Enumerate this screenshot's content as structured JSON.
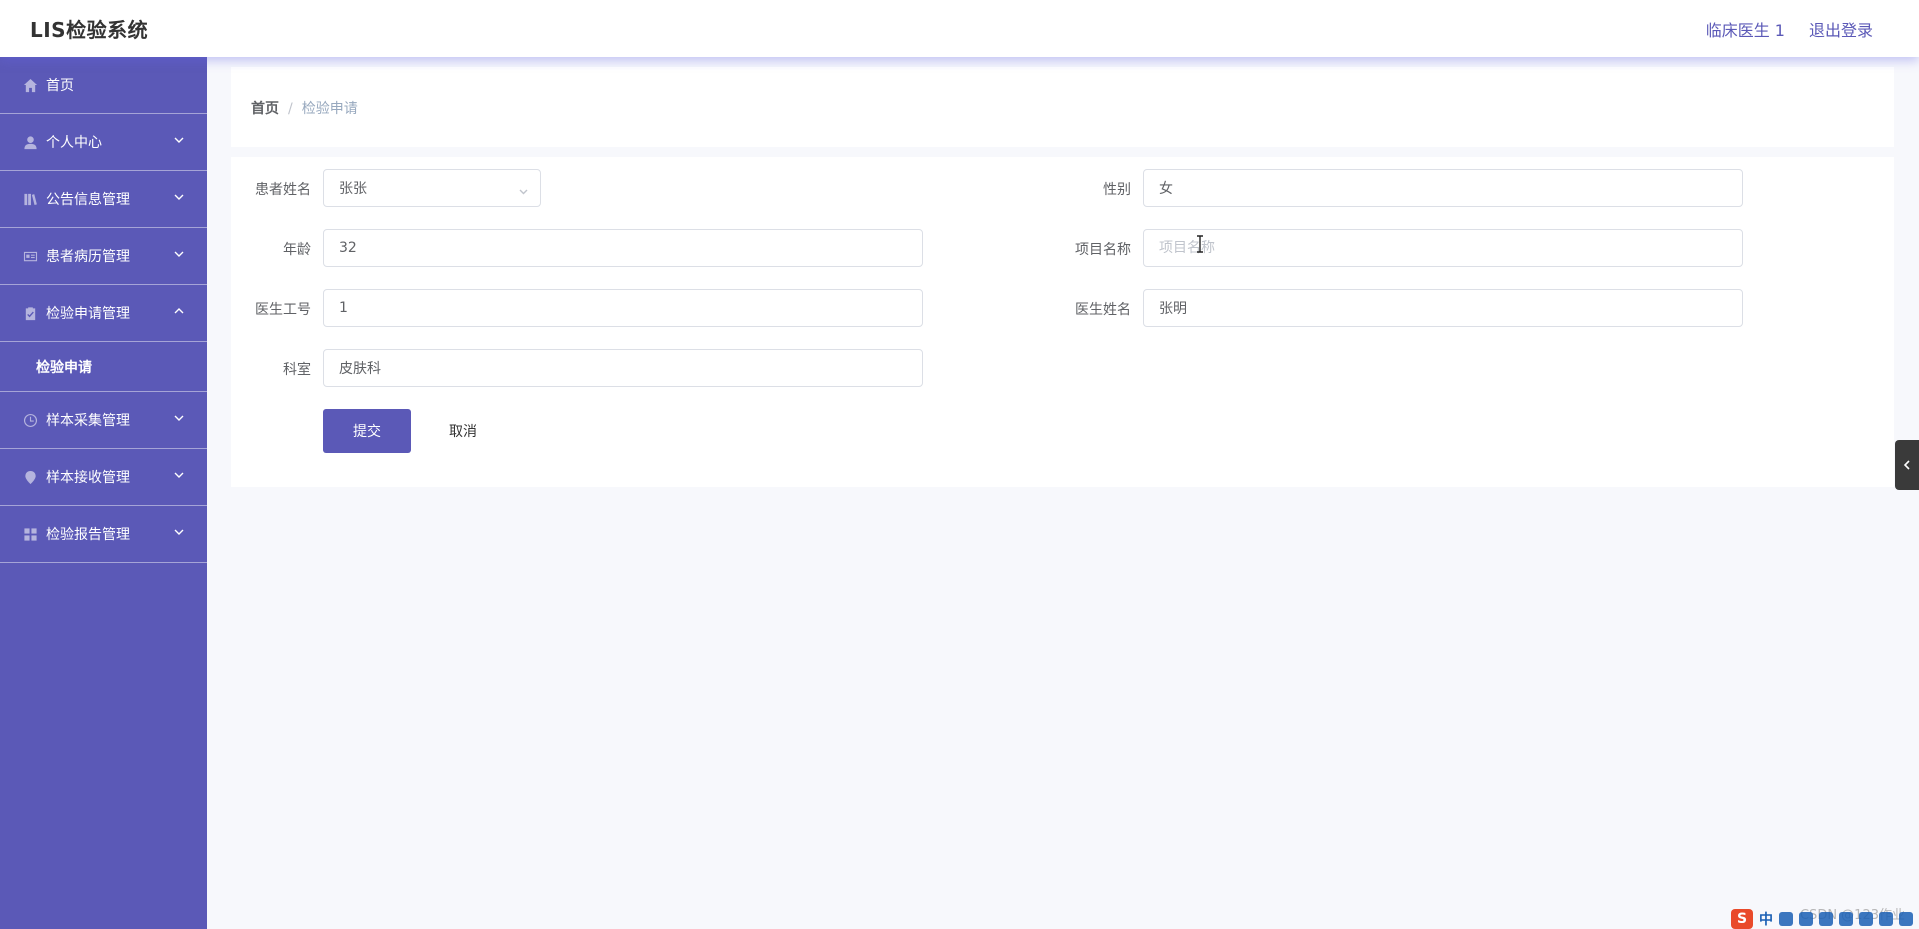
{
  "header": {
    "title": "LIS检验系统",
    "user_label": "临床医生 1",
    "logout_label": "退出登录"
  },
  "sidebar": {
    "items": [
      {
        "label": "首页",
        "icon": "home-icon",
        "expandable": false
      },
      {
        "label": "个人中心",
        "icon": "user-icon",
        "expandable": true,
        "expanded": false
      },
      {
        "label": "公告信息管理",
        "icon": "book-icon",
        "expandable": true,
        "expanded": false
      },
      {
        "label": "患者病历管理",
        "icon": "id-card-icon",
        "expandable": true,
        "expanded": false
      },
      {
        "label": "检验申请管理",
        "icon": "clipboard-icon",
        "expandable": true,
        "expanded": true
      },
      {
        "label": "样本采集管理",
        "icon": "clock-icon",
        "expandable": true,
        "expanded": false
      },
      {
        "label": "样本接收管理",
        "icon": "location-icon",
        "expandable": true,
        "expanded": false
      },
      {
        "label": "检验报告管理",
        "icon": "grid-icon",
        "expandable": true,
        "expanded": false
      }
    ],
    "submenu_active": "检验申请"
  },
  "breadcrumb": {
    "home": "首页",
    "separator": "/",
    "current": "检验申请"
  },
  "form": {
    "patient_name": {
      "label": "患者姓名",
      "value": "张张"
    },
    "gender": {
      "label": "性别",
      "value": "女"
    },
    "age": {
      "label": "年龄",
      "value": "32"
    },
    "project_name": {
      "label": "项目名称",
      "value": "",
      "placeholder": "项目名称"
    },
    "doctor_id": {
      "label": "医生工号",
      "value": "1"
    },
    "doctor_name": {
      "label": "医生姓名",
      "value": "张明"
    },
    "department": {
      "label": "科室",
      "value": "皮肤科"
    },
    "submit_label": "提交",
    "cancel_label": "取消"
  },
  "ime": {
    "logo": "S",
    "mode": "中",
    "watermark": "CSDN @123作业"
  },
  "colors": {
    "primary": "#5b59b7",
    "background": "#f7f8fc"
  }
}
